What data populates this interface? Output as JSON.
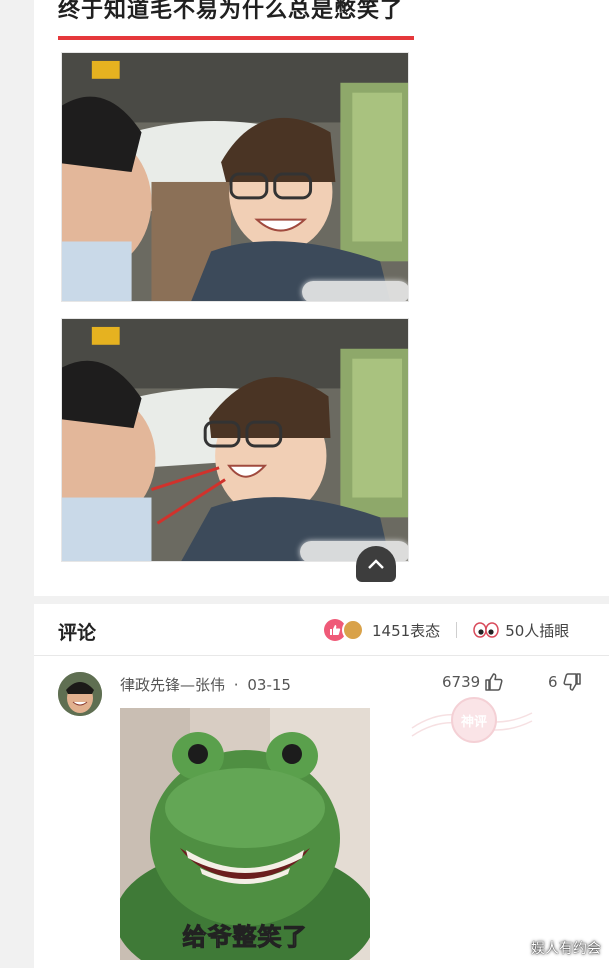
{
  "post": {
    "title": "终于知道毛不易为什么总是憋笑了"
  },
  "comments_section": {
    "heading": "评论",
    "reactions_count": "1451表态",
    "spectators_count": "50人插眼"
  },
  "comment": {
    "author": "律政先锋—张伟",
    "separator": "·",
    "date": "03-15",
    "upvotes": "6739",
    "downvotes": "6",
    "meme_caption": "给爷整笑了",
    "stamp_text": "神评"
  },
  "watermark": "娱人有约会",
  "icons": {
    "scroll_top": "chevron-up-icon",
    "like": "thumbs-up-icon",
    "dislike": "thumbs-down-icon",
    "eyes": "eyes-icon"
  },
  "colors": {
    "accent_red": "#e5383b",
    "like_pink": "#ef5a78"
  }
}
